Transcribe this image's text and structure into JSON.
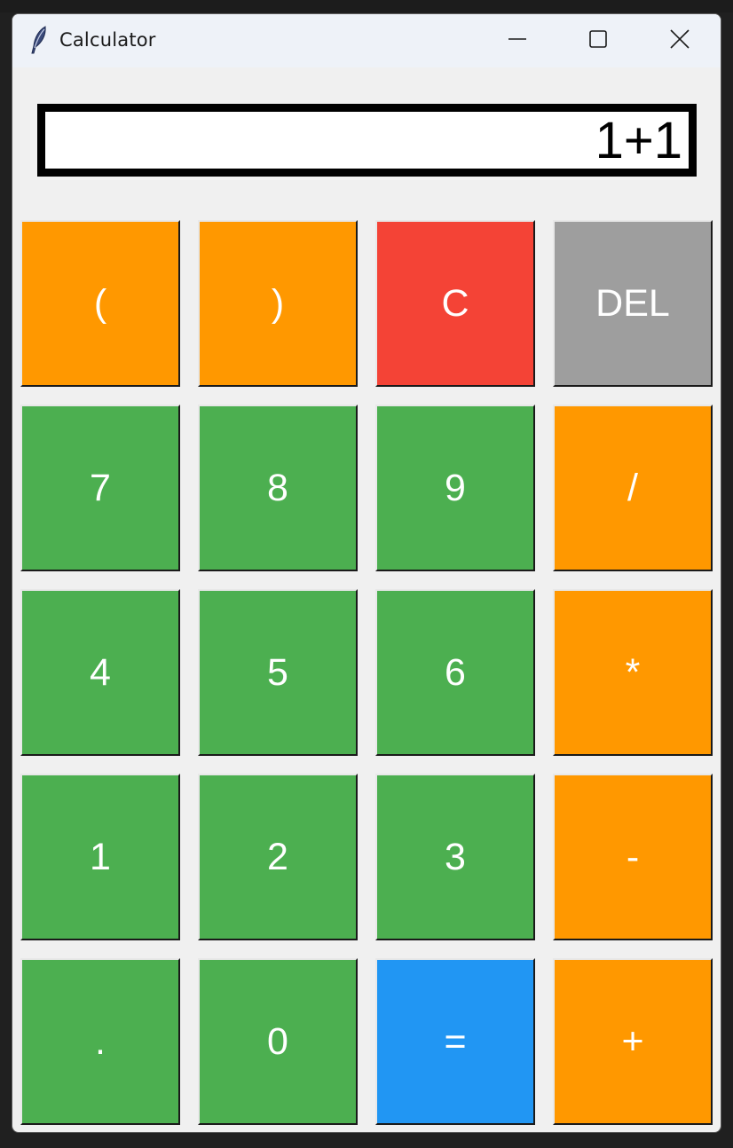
{
  "window": {
    "title": "Calculator",
    "app_icon": "feather-icon",
    "controls": {
      "minimize_icon": "minimize-icon",
      "maximize_icon": "maximize-icon",
      "close_icon": "close-icon"
    }
  },
  "display": {
    "value": "1+1"
  },
  "colors": {
    "orange": "#ff9800",
    "green": "#4caf50",
    "red": "#f44336",
    "gray": "#9e9e9e",
    "blue": "#2196f3"
  },
  "buttons": {
    "open_paren": "(",
    "close_paren": ")",
    "clear": "C",
    "delete": "DEL",
    "seven": "7",
    "eight": "8",
    "nine": "9",
    "divide": "/",
    "four": "4",
    "five": "5",
    "six": "6",
    "multiply": "*",
    "one": "1",
    "two": "2",
    "three": "3",
    "subtract": "-",
    "decimal": ".",
    "zero": "0",
    "equals": "=",
    "add": "+"
  }
}
